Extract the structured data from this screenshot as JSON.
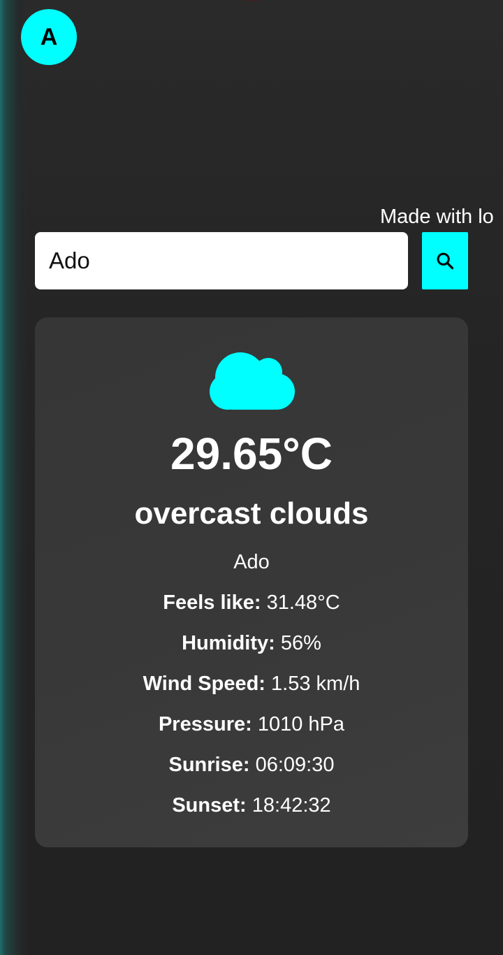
{
  "header": {
    "avatar_letter": "A",
    "credit_text": "Made with lo"
  },
  "search": {
    "value": "Ado",
    "placeholder": "",
    "button_icon": "search-icon"
  },
  "weather": {
    "icon": "cloud-icon",
    "temperature": "29.65°C",
    "description": "overcast clouds",
    "city": "Ado",
    "details": [
      {
        "label": "Feels like:",
        "value": "31.48°C"
      },
      {
        "label": "Humidity:",
        "value": "56%"
      },
      {
        "label": "Wind Speed:",
        "value": "1.53 km/h"
      },
      {
        "label": "Pressure:",
        "value": "1010 hPa"
      },
      {
        "label": "Sunrise:",
        "value": "06:09:30"
      },
      {
        "label": "Sunset:",
        "value": "18:42:32"
      }
    ]
  },
  "colors": {
    "accent": "#00ffff",
    "background": "#262626",
    "card": "#383838",
    "text": "#ffffff"
  }
}
